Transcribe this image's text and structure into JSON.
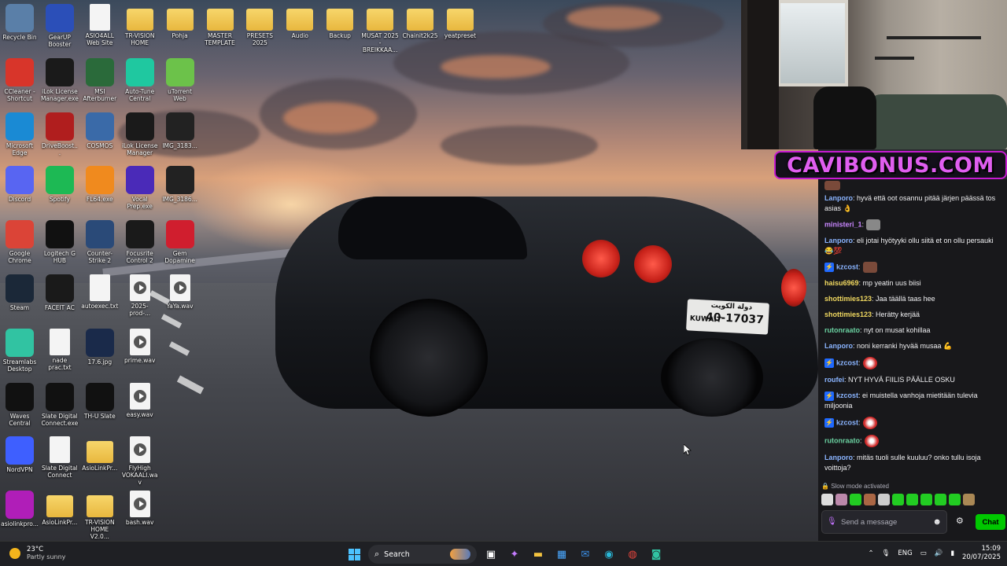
{
  "desktop_icons": [
    {
      "label": "Recycle Bin",
      "icon": "recycle-bin-icon",
      "color": "#5a7fa8"
    },
    {
      "label": "GearUP Booster",
      "icon": "gearup-icon",
      "color": "#2b4fb8"
    },
    {
      "label": "ASIO4ALL Web Site",
      "icon": "file-icon",
      "color": "#f4f4f4"
    },
    {
      "label": "TR-VISION HOME",
      "icon": "folder-icon",
      "color": "#e8b73e"
    },
    {
      "label": "Pohja",
      "icon": "folder-icon",
      "color": "#e8b73e"
    },
    {
      "label": "MASTER TEMPLATE",
      "icon": "folder-icon",
      "color": "#e8b73e"
    },
    {
      "label": "PRESETS 2025",
      "icon": "folder-icon",
      "color": "#e8b73e"
    },
    {
      "label": "Audio",
      "icon": "folder-icon",
      "color": "#e8b73e"
    },
    {
      "label": "Backup",
      "icon": "folder-icon",
      "color": "#e8b73e"
    },
    {
      "label": "MUSAT 2025 - BREIKKAA...",
      "icon": "folder-icon",
      "color": "#e8b73e"
    },
    {
      "label": "Chainit2k25",
      "icon": "folder-icon",
      "color": "#e8b73e"
    },
    {
      "label": "yeatpreset",
      "icon": "folder-icon",
      "color": "#e8b73e"
    },
    {
      "label": "CCleaner - Shortcut",
      "icon": "ccleaner-icon",
      "color": "#d8352a"
    },
    {
      "label": "iLok License Manager.exe",
      "icon": "ilok-icon",
      "color": "#1a1a1a"
    },
    {
      "label": "MSI Afterburner",
      "icon": "msi-icon",
      "color": "#2a6a3a"
    },
    {
      "label": "Auto-Tune Central",
      "icon": "autotune-icon",
      "color": "#1fc8a0"
    },
    {
      "label": "uTorrent Web",
      "icon": "utorrent-icon",
      "color": "#6cc24a"
    },
    {
      "label": "Microsoft Edge",
      "icon": "edge-icon",
      "color": "#1a8ad4"
    },
    {
      "label": "DriveBoost...",
      "icon": "driveboost-icon",
      "color": "#b01e1e"
    },
    {
      "label": "COSMOS",
      "icon": "cosmos-icon",
      "color": "#3a6aa8"
    },
    {
      "label": "iLok License Manager",
      "icon": "ilok-icon",
      "color": "#1a1a1a"
    },
    {
      "label": "IMG_3183...",
      "icon": "image-icon",
      "color": "#222"
    },
    {
      "label": "Discord",
      "icon": "discord-icon",
      "color": "#5865f2"
    },
    {
      "label": "Spotify",
      "icon": "spotify-icon",
      "color": "#1db954"
    },
    {
      "label": "FL64.exe",
      "icon": "flstudio-icon",
      "color": "#f08a1e"
    },
    {
      "label": "Vocal Prep.exe",
      "icon": "vocalprep-icon",
      "color": "#4a2ab8"
    },
    {
      "label": "IMG_3186...",
      "icon": "image-icon",
      "color": "#222"
    },
    {
      "label": "Google Chrome",
      "icon": "chrome-icon",
      "color": "#db4437"
    },
    {
      "label": "Logitech G HUB",
      "icon": "logitech-icon",
      "color": "#111"
    },
    {
      "label": "Counter-Strike 2",
      "icon": "cs2-icon",
      "color": "#2a4a78"
    },
    {
      "label": "Focusrite Control 2",
      "icon": "focusrite-icon",
      "color": "#1a1a1a"
    },
    {
      "label": "Gem Dopamine",
      "icon": "gem-icon",
      "color": "#d01e2e"
    },
    {
      "label": "Steam",
      "icon": "steam-icon",
      "color": "#1b2838"
    },
    {
      "label": "FACEIT AC",
      "icon": "faceit-icon",
      "color": "#1a1a1a"
    },
    {
      "label": "autoexec.txt",
      "icon": "file-icon",
      "color": "#f4f4f4"
    },
    {
      "label": "2025-prod-...",
      "icon": "wav-icon",
      "color": "#f4f4f4"
    },
    {
      "label": "YaYa.wav",
      "icon": "wav-icon",
      "color": "#f4f4f4"
    },
    {
      "label": "Streamlabs Desktop",
      "icon": "streamlabs-icon",
      "color": "#31c3a2"
    },
    {
      "label": "nade prac.txt",
      "icon": "file-icon",
      "color": "#f4f4f4"
    },
    {
      "label": "17.6.jpg",
      "icon": "image-icon",
      "color": "#1a2a4a"
    },
    {
      "label": "prime.wav",
      "icon": "wav-icon",
      "color": "#f4f4f4"
    },
    {
      "label": "Waves Central",
      "icon": "waves-icon",
      "color": "#111"
    },
    {
      "label": "Slate Digital Connect.exe",
      "icon": "slate-icon",
      "color": "#111"
    },
    {
      "label": "TH-U Slate",
      "icon": "thu-icon",
      "color": "#111"
    },
    {
      "label": "easy.wav",
      "icon": "wav-icon",
      "color": "#f4f4f4"
    },
    {
      "label": "NordVPN",
      "icon": "nordvpn-icon",
      "color": "#3e5fff"
    },
    {
      "label": "Slate Digital Connect",
      "icon": "file-icon",
      "color": "#f4f4f4"
    },
    {
      "label": "AsioLinkPr...",
      "icon": "folder-icon",
      "color": "#e8b73e"
    },
    {
      "label": "FlyHigh VOKAALI.wav",
      "icon": "wav-icon",
      "color": "#f4f4f4"
    },
    {
      "label": "asiolinkpro...",
      "icon": "asiolink-icon",
      "color": "#b01eb8"
    },
    {
      "label": "AsioLinkPr...",
      "icon": "folder-icon",
      "color": "#e8b73e"
    },
    {
      "label": "TR-VISION HOME V2.0...",
      "icon": "folder-icon",
      "color": "#e8b73e"
    },
    {
      "label": "bash.wav",
      "icon": "wav-icon",
      "color": "#f4f4f4"
    }
  ],
  "banner": {
    "text": "CAVIBONUS.COM"
  },
  "chat": {
    "messages": [
      {
        "user": "Lanporo",
        "color": "#8ab4ff",
        "badge": false,
        "text": ": hyvä että oot osannu pitää järjen päässä tos asias 👌"
      },
      {
        "user": "ministeri_1",
        "color": "#c987ff",
        "badge": false,
        "text": ":",
        "emote": "gray"
      },
      {
        "user": "Lanporo",
        "color": "#8ab4ff",
        "badge": false,
        "text": ": eli jotai hyötyyki ollu siitä et on ollu persauki 😂💯"
      },
      {
        "user": "kzcost",
        "color": "#8ab4ff",
        "badge": true,
        "text": ":",
        "emote": "brown"
      },
      {
        "user": "haisu6969",
        "color": "#f0d860",
        "badge": false,
        "text": ": mp yeatin uus biisi"
      },
      {
        "user": "shottimies123",
        "color": "#f0d860",
        "badge": false,
        "text": ": Jaa täällä taas hee"
      },
      {
        "user": "shottimies123",
        "color": "#f0d860",
        "badge": false,
        "text": ": Herätty kerjää"
      },
      {
        "user": "rutonraato",
        "color": "#6ad0a0",
        "badge": false,
        "text": ": nyt on musat kohillaa"
      },
      {
        "user": "Lanporo",
        "color": "#8ab4ff",
        "badge": false,
        "text": ": noni kerranki hyvää musaa 💪"
      },
      {
        "user": "kzcost",
        "color": "#8ab4ff",
        "badge": true,
        "text": ":",
        "emote": "red"
      },
      {
        "user": "roufei",
        "color": "#8ab4ff",
        "badge": false,
        "text": ": NYT HYVÄ FIILIS PÄÄLLE OSKU"
      },
      {
        "user": "kzcost",
        "color": "#8ab4ff",
        "badge": true,
        "text": ": ei muistella vanhoja mietitään tulevia miljoonia"
      },
      {
        "user": "kzcost",
        "color": "#8ab4ff",
        "badge": true,
        "text": ":",
        "emote": "red"
      },
      {
        "user": "rutonraato",
        "color": "#6ad0a0",
        "badge": false,
        "text": ":",
        "emote": "red"
      },
      {
        "user": "Lanporo",
        "color": "#8ab4ff",
        "badge": false,
        "text": ": mitäs tuoli sulle kuuluu? onko tullu isoja voittoja?"
      }
    ],
    "slow_mode": "Slow mode activated",
    "input_placeholder": "Send a message",
    "chat_button": "Chat",
    "accent": "#00c800"
  },
  "taskbar": {
    "weather_temp": "23°C",
    "weather_desc": "Partly sunny",
    "search_placeholder": "Search",
    "language": "ENG",
    "time": "15:09",
    "date": "20/07/2025"
  }
}
